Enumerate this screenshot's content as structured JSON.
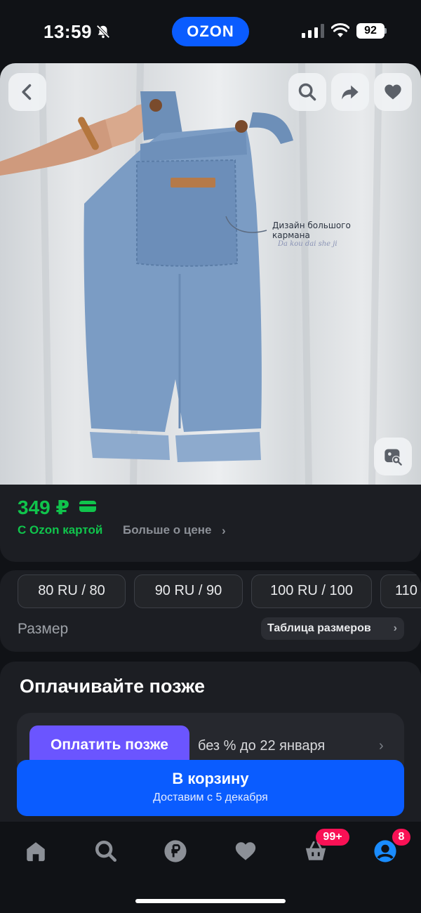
{
  "status": {
    "time": "13:59",
    "app_logo": "OZON",
    "battery": "92",
    "icons": [
      "bell-slash-icon",
      "signal-icon",
      "wifi-icon",
      "battery-icon"
    ]
  },
  "image_overlay": {
    "annotation_line1": "Дизайн большого",
    "annotation_line2": "кармана",
    "annotation_sub": "Da kou dai she ji",
    "icons": [
      "chevron-left-icon",
      "search-icon",
      "share-icon",
      "heart-icon",
      "image-search-icon"
    ]
  },
  "price": {
    "value": "349 ₽",
    "ozon_card": "С Ozon картой",
    "more": "Больше о цене",
    "accent": "#10c44c"
  },
  "sizes": {
    "options": [
      "80 RU / 80",
      "90 RU / 90",
      "100 RU / 100",
      "110"
    ],
    "label": "Размер",
    "table_button": "Таблица размеров"
  },
  "pay_later": {
    "title": "Оплачивайте позже",
    "button": "Оплатить позже",
    "terms": "без % до 22 января",
    "accent": "#6b55ff"
  },
  "cart": {
    "title": "В корзину",
    "subtitle": "Доставим с 5 декабря",
    "color": "#0a5cff"
  },
  "nav": {
    "cart_badge": "99+",
    "profile_badge": "8",
    "items": [
      "home-icon",
      "search-icon",
      "ruble-icon",
      "heart-icon",
      "basket-icon",
      "profile-icon"
    ],
    "active_color": "#1a8cff"
  }
}
